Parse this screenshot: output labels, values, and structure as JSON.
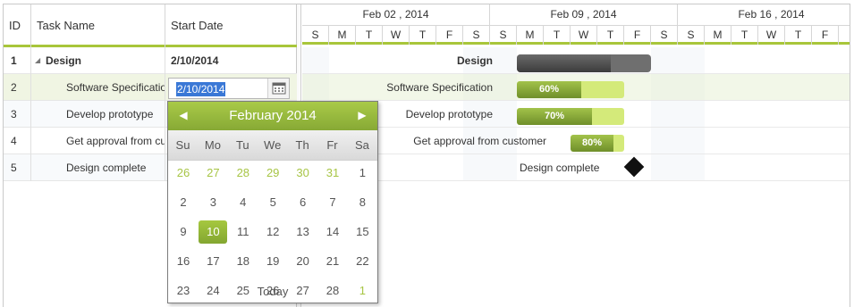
{
  "grid": {
    "headers": {
      "id": "ID",
      "name": "Task Name",
      "start": "Start Date"
    },
    "rows": [
      {
        "id": "1",
        "name": "Design",
        "start": "2/10/2014"
      },
      {
        "id": "2",
        "name": "Software Specification",
        "start": "2/10/2014"
      },
      {
        "id": "3",
        "name": "Develop prototype",
        "start": ""
      },
      {
        "id": "4",
        "name": "Get approval from customer",
        "start": ""
      },
      {
        "id": "5",
        "name": "Design complete",
        "start": ""
      }
    ],
    "editor_value": "2/10/2014",
    "icons": {
      "expander": "collapse-triangle-icon",
      "calendar": "calendar-icon"
    }
  },
  "timeline": {
    "weeks": [
      "Feb 02 , 2014",
      "Feb 09 , 2014",
      "Feb 16 , 2014"
    ],
    "day_letters": [
      "S",
      "M",
      "T",
      "W",
      "T",
      "F",
      "S",
      "S",
      "M",
      "T",
      "W",
      "T",
      "F",
      "S",
      "S",
      "M",
      "T",
      "W",
      "T",
      "F"
    ]
  },
  "chart_labels": {
    "design": "Design",
    "spec": "Software Specification",
    "proto": "Develop prototype",
    "approval": "Get approval from customer",
    "complete": "Design complete"
  },
  "progress": {
    "design": 0.7,
    "spec": {
      "value": 0.6,
      "label": "60%"
    },
    "proto": {
      "value": 0.7,
      "label": "70%"
    },
    "approval": {
      "value": 0.8,
      "label": "80%"
    }
  },
  "calendar": {
    "title": "February 2014",
    "prev_icon": "chevron-left-icon",
    "next_icon": "chevron-right-icon",
    "weekdays": [
      "Su",
      "Mo",
      "Tu",
      "We",
      "Th",
      "Fr",
      "Sa"
    ],
    "weeks": [
      [
        "26",
        "27",
        "28",
        "29",
        "30",
        "31",
        "1"
      ],
      [
        "2",
        "3",
        "4",
        "5",
        "6",
        "7",
        "8"
      ],
      [
        "9",
        "10",
        "11",
        "12",
        "13",
        "14",
        "15"
      ],
      [
        "16",
        "17",
        "18",
        "19",
        "20",
        "21",
        "22"
      ],
      [
        "23",
        "24",
        "25",
        "26",
        "27",
        "28",
        "1"
      ]
    ],
    "selected_day": "10",
    "today_label": "Today",
    "colors": {
      "accent": "#9dbd3f",
      "other_month": "#a7c545"
    }
  }
}
